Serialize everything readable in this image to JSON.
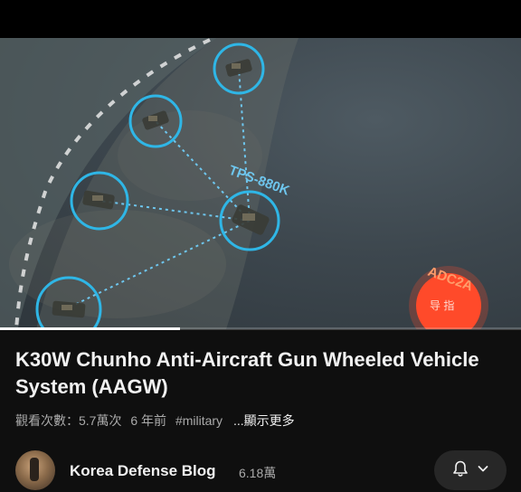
{
  "video": {
    "overlay_labels": {
      "radar": "TPS-880K",
      "command": "ADC2A",
      "command_sub": "导 指"
    },
    "progress_fraction": 0.345,
    "colors": {
      "ring": "#2fb6e6",
      "command": "#ff4a2a"
    }
  },
  "title": "K30W Chunho Anti-Aircraft Gun Wheeled Vehicle System (AAGW)",
  "meta": {
    "views": "觀看次數：5.7萬次",
    "age": "6 年前",
    "hashtag": "#military",
    "more": "...顯示更多"
  },
  "channel": {
    "name": "Korea Defense Blog",
    "subscribers": "6.18萬"
  },
  "icons": {
    "bell": "bell-icon",
    "dropdown": "chevron-down-icon"
  }
}
